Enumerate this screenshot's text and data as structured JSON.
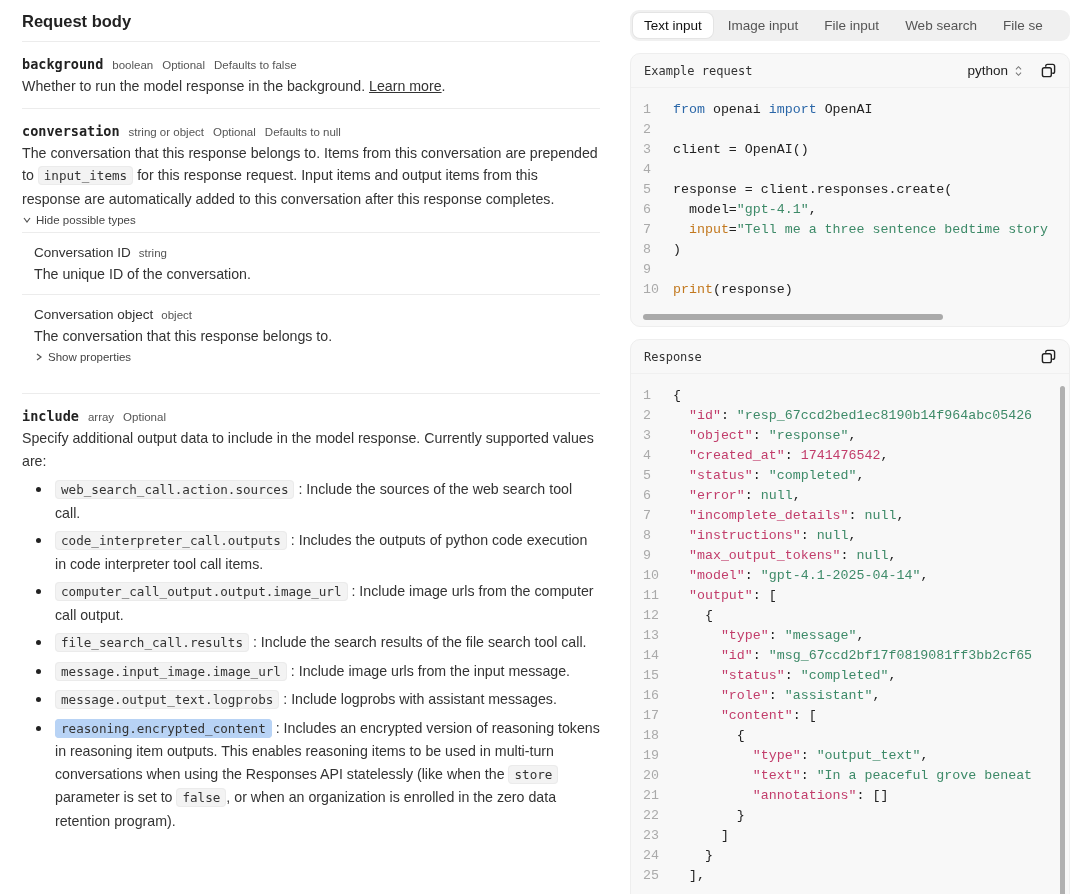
{
  "request_body": {
    "title": "Request body",
    "params": [
      {
        "name": "background",
        "meta": [
          "boolean",
          "Optional",
          "Defaults to false"
        ],
        "description": [
          {
            "kind": "text",
            "text": "Whether to run the model response in the background. "
          },
          {
            "kind": "link",
            "text": "Learn more"
          },
          {
            "kind": "text",
            "text": "."
          }
        ]
      },
      {
        "name": "conversation",
        "meta": [
          "string or object",
          "Optional",
          "Defaults to null"
        ],
        "description": [
          {
            "kind": "text",
            "text": "The conversation that this response belongs to. Items from this conversation are prepended to "
          },
          {
            "kind": "code",
            "text": "input_items",
            "highlighted": false
          },
          {
            "kind": "text",
            "text": " for this response request. Input items and output items from this response are automatically added to this conversation after this response completes."
          }
        ],
        "toggle": {
          "label": "Hide possible types",
          "expanded": true
        },
        "types": [
          {
            "name": "Conversation ID",
            "type": "string",
            "description": "The unique ID of the conversation."
          },
          {
            "name": "Conversation object",
            "type": "object",
            "description": "The conversation that this response belongs to.",
            "toggle": {
              "label": "Show properties",
              "expanded": false
            }
          }
        ]
      },
      {
        "name": "include",
        "meta": [
          "array",
          "Optional"
        ],
        "description": [
          {
            "kind": "text",
            "text": "Specify additional output data to include in the model response. Currently supported values are:"
          }
        ],
        "values": [
          [
            {
              "kind": "code",
              "text": "web_search_call.action.sources",
              "highlighted": false
            },
            {
              "kind": "text",
              "text": " : Include the sources of the web search tool call."
            }
          ],
          [
            {
              "kind": "code",
              "text": "code_interpreter_call.outputs",
              "highlighted": false
            },
            {
              "kind": "text",
              "text": " : Includes the outputs of python code execution in code interpreter tool call items."
            }
          ],
          [
            {
              "kind": "code",
              "text": "computer_call_output.output.image_url",
              "highlighted": false
            },
            {
              "kind": "text",
              "text": " : Include image urls from the computer call output."
            }
          ],
          [
            {
              "kind": "code",
              "text": "file_search_call.results",
              "highlighted": false
            },
            {
              "kind": "text",
              "text": " : Include the search results of the file search tool call."
            }
          ],
          [
            {
              "kind": "code",
              "text": "message.input_image.image_url",
              "highlighted": false
            },
            {
              "kind": "text",
              "text": " : Include image urls from the input message."
            }
          ],
          [
            {
              "kind": "code",
              "text": "message.output_text.logprobs",
              "highlighted": false
            },
            {
              "kind": "text",
              "text": " : Include logprobs with assistant messages."
            }
          ],
          [
            {
              "kind": "code",
              "text": "reasoning.encrypted_content",
              "highlighted": true
            },
            {
              "kind": "text",
              "text": " : Includes an encrypted version of reasoning tokens in reasoning item outputs. This enables reasoning items to be used in multi-turn conversations when using the Responses API statelessly (like when the "
            },
            {
              "kind": "code",
              "text": "store",
              "highlighted": false
            },
            {
              "kind": "text",
              "text": " parameter is set to "
            },
            {
              "kind": "code",
              "text": "false",
              "highlighted": false
            },
            {
              "kind": "text",
              "text": ", or when an organization is enrolled in the zero data retention program)."
            }
          ]
        ]
      }
    ]
  },
  "examples": {
    "tabs": [
      {
        "label": "Text input",
        "selected": true
      },
      {
        "label": "Image input",
        "selected": false
      },
      {
        "label": "File input",
        "selected": false
      },
      {
        "label": "Web search",
        "selected": false
      },
      {
        "label": "File se",
        "selected": false
      }
    ],
    "request": {
      "title": "Example request",
      "language": "python",
      "lines": [
        {
          "number": "1",
          "tokens": [
            {
              "kind": "keyword",
              "text": "from"
            },
            {
              "kind": "plain",
              "text": " openai "
            },
            {
              "kind": "keyword",
              "text": "import"
            },
            {
              "kind": "plain",
              "text": " OpenAI"
            }
          ]
        },
        {
          "number": "2"
        },
        {
          "number": "3",
          "tokens": [
            {
              "kind": "plain",
              "text": "client = OpenAI()"
            }
          ]
        },
        {
          "number": "4"
        },
        {
          "number": "5",
          "tokens": [
            {
              "kind": "plain",
              "text": "response = client.responses.create("
            }
          ]
        },
        {
          "number": "6",
          "tokens": [
            {
              "kind": "plain",
              "text": "  model="
            },
            {
              "kind": "string",
              "text": "\"gpt-4.1\""
            },
            {
              "kind": "plain",
              "text": ","
            }
          ]
        },
        {
          "number": "7",
          "tokens": [
            {
              "kind": "builtin",
              "text": "  input"
            },
            {
              "kind": "plain",
              "text": "="
            },
            {
              "kind": "string",
              "text": "\"Tell me a three sentence bedtime story"
            }
          ]
        },
        {
          "number": "8",
          "tokens": [
            {
              "kind": "plain",
              "text": ")"
            }
          ]
        },
        {
          "number": "9"
        },
        {
          "number": "10",
          "tokens": [
            {
              "kind": "builtin",
              "text": "print"
            },
            {
              "kind": "plain",
              "text": "(response)"
            }
          ]
        }
      ]
    },
    "response": {
      "title": "Response",
      "lines": [
        {
          "number": "1",
          "tokens": [
            {
              "kind": "plain",
              "text": "{"
            }
          ]
        },
        {
          "number": "2",
          "tokens": [
            {
              "kind": "key",
              "text": "  \"id\""
            },
            {
              "kind": "plain",
              "text": ": "
            },
            {
              "kind": "string",
              "text": "\"resp_67ccd2bed1ec8190b14f964abc05426"
            }
          ]
        },
        {
          "number": "3",
          "tokens": [
            {
              "kind": "key",
              "text": "  \"object\""
            },
            {
              "kind": "plain",
              "text": ": "
            },
            {
              "kind": "string",
              "text": "\"response\""
            },
            {
              "kind": "plain",
              "text": ","
            }
          ]
        },
        {
          "number": "4",
          "tokens": [
            {
              "kind": "key",
              "text": "  \"created_at\""
            },
            {
              "kind": "plain",
              "text": ": "
            },
            {
              "kind": "number",
              "text": "1741476542"
            },
            {
              "kind": "plain",
              "text": ","
            }
          ]
        },
        {
          "number": "5",
          "tokens": [
            {
              "kind": "key",
              "text": "  \"status\""
            },
            {
              "kind": "plain",
              "text": ": "
            },
            {
              "kind": "string",
              "text": "\"completed\""
            },
            {
              "kind": "plain",
              "text": ","
            }
          ]
        },
        {
          "number": "6",
          "tokens": [
            {
              "kind": "key",
              "text": "  \"error\""
            },
            {
              "kind": "plain",
              "text": ": "
            },
            {
              "kind": "string",
              "text": "null"
            },
            {
              "kind": "plain",
              "text": ","
            }
          ]
        },
        {
          "number": "7",
          "tokens": [
            {
              "kind": "key",
              "text": "  \"incomplete_details\""
            },
            {
              "kind": "plain",
              "text": ": "
            },
            {
              "kind": "string",
              "text": "null"
            },
            {
              "kind": "plain",
              "text": ","
            }
          ]
        },
        {
          "number": "8",
          "tokens": [
            {
              "kind": "key",
              "text": "  \"instructions\""
            },
            {
              "kind": "plain",
              "text": ": "
            },
            {
              "kind": "string",
              "text": "null"
            },
            {
              "kind": "plain",
              "text": ","
            }
          ]
        },
        {
          "number": "9",
          "tokens": [
            {
              "kind": "key",
              "text": "  \"max_output_tokens\""
            },
            {
              "kind": "plain",
              "text": ": "
            },
            {
              "kind": "string",
              "text": "null"
            },
            {
              "kind": "plain",
              "text": ","
            }
          ]
        },
        {
          "number": "10",
          "tokens": [
            {
              "kind": "key",
              "text": "  \"model\""
            },
            {
              "kind": "plain",
              "text": ": "
            },
            {
              "kind": "string",
              "text": "\"gpt-4.1-2025-04-14\""
            },
            {
              "kind": "plain",
              "text": ","
            }
          ]
        },
        {
          "number": "11",
          "tokens": [
            {
              "kind": "key",
              "text": "  \"output\""
            },
            {
              "kind": "plain",
              "text": ": ["
            }
          ]
        },
        {
          "number": "12",
          "tokens": [
            {
              "kind": "plain",
              "text": "    {"
            }
          ]
        },
        {
          "number": "13",
          "tokens": [
            {
              "kind": "key",
              "text": "      \"type\""
            },
            {
              "kind": "plain",
              "text": ": "
            },
            {
              "kind": "string",
              "text": "\"message\""
            },
            {
              "kind": "plain",
              "text": ","
            }
          ]
        },
        {
          "number": "14",
          "tokens": [
            {
              "kind": "key",
              "text": "      \"id\""
            },
            {
              "kind": "plain",
              "text": ": "
            },
            {
              "kind": "string",
              "text": "\"msg_67ccd2bf17f0819081ff3bb2cf65"
            }
          ]
        },
        {
          "number": "15",
          "tokens": [
            {
              "kind": "key",
              "text": "      \"status\""
            },
            {
              "kind": "plain",
              "text": ": "
            },
            {
              "kind": "string",
              "text": "\"completed\""
            },
            {
              "kind": "plain",
              "text": ","
            }
          ]
        },
        {
          "number": "16",
          "tokens": [
            {
              "kind": "key",
              "text": "      \"role\""
            },
            {
              "kind": "plain",
              "text": ": "
            },
            {
              "kind": "string",
              "text": "\"assistant\""
            },
            {
              "kind": "plain",
              "text": ","
            }
          ]
        },
        {
          "number": "17",
          "tokens": [
            {
              "kind": "key",
              "text": "      \"content\""
            },
            {
              "kind": "plain",
              "text": ": ["
            }
          ]
        },
        {
          "number": "18",
          "tokens": [
            {
              "kind": "plain",
              "text": "        {"
            }
          ]
        },
        {
          "number": "19",
          "tokens": [
            {
              "kind": "key",
              "text": "          \"type\""
            },
            {
              "kind": "plain",
              "text": ": "
            },
            {
              "kind": "string",
              "text": "\"output_text\""
            },
            {
              "kind": "plain",
              "text": ","
            }
          ]
        },
        {
          "number": "20",
          "tokens": [
            {
              "kind": "key",
              "text": "          \"text\""
            },
            {
              "kind": "plain",
              "text": ": "
            },
            {
              "kind": "string",
              "text": "\"In a peaceful grove beneat"
            }
          ]
        },
        {
          "number": "21",
          "tokens": [
            {
              "kind": "key",
              "text": "          \"annotations\""
            },
            {
              "kind": "plain",
              "text": ": []"
            }
          ]
        },
        {
          "number": "22",
          "tokens": [
            {
              "kind": "plain",
              "text": "        }"
            }
          ]
        },
        {
          "number": "23",
          "tokens": [
            {
              "kind": "plain",
              "text": "      ]"
            }
          ]
        },
        {
          "number": "24",
          "tokens": [
            {
              "kind": "plain",
              "text": "    }"
            }
          ]
        },
        {
          "number": "25",
          "tokens": [
            {
              "kind": "plain",
              "text": "  ],"
            }
          ]
        }
      ]
    }
  }
}
